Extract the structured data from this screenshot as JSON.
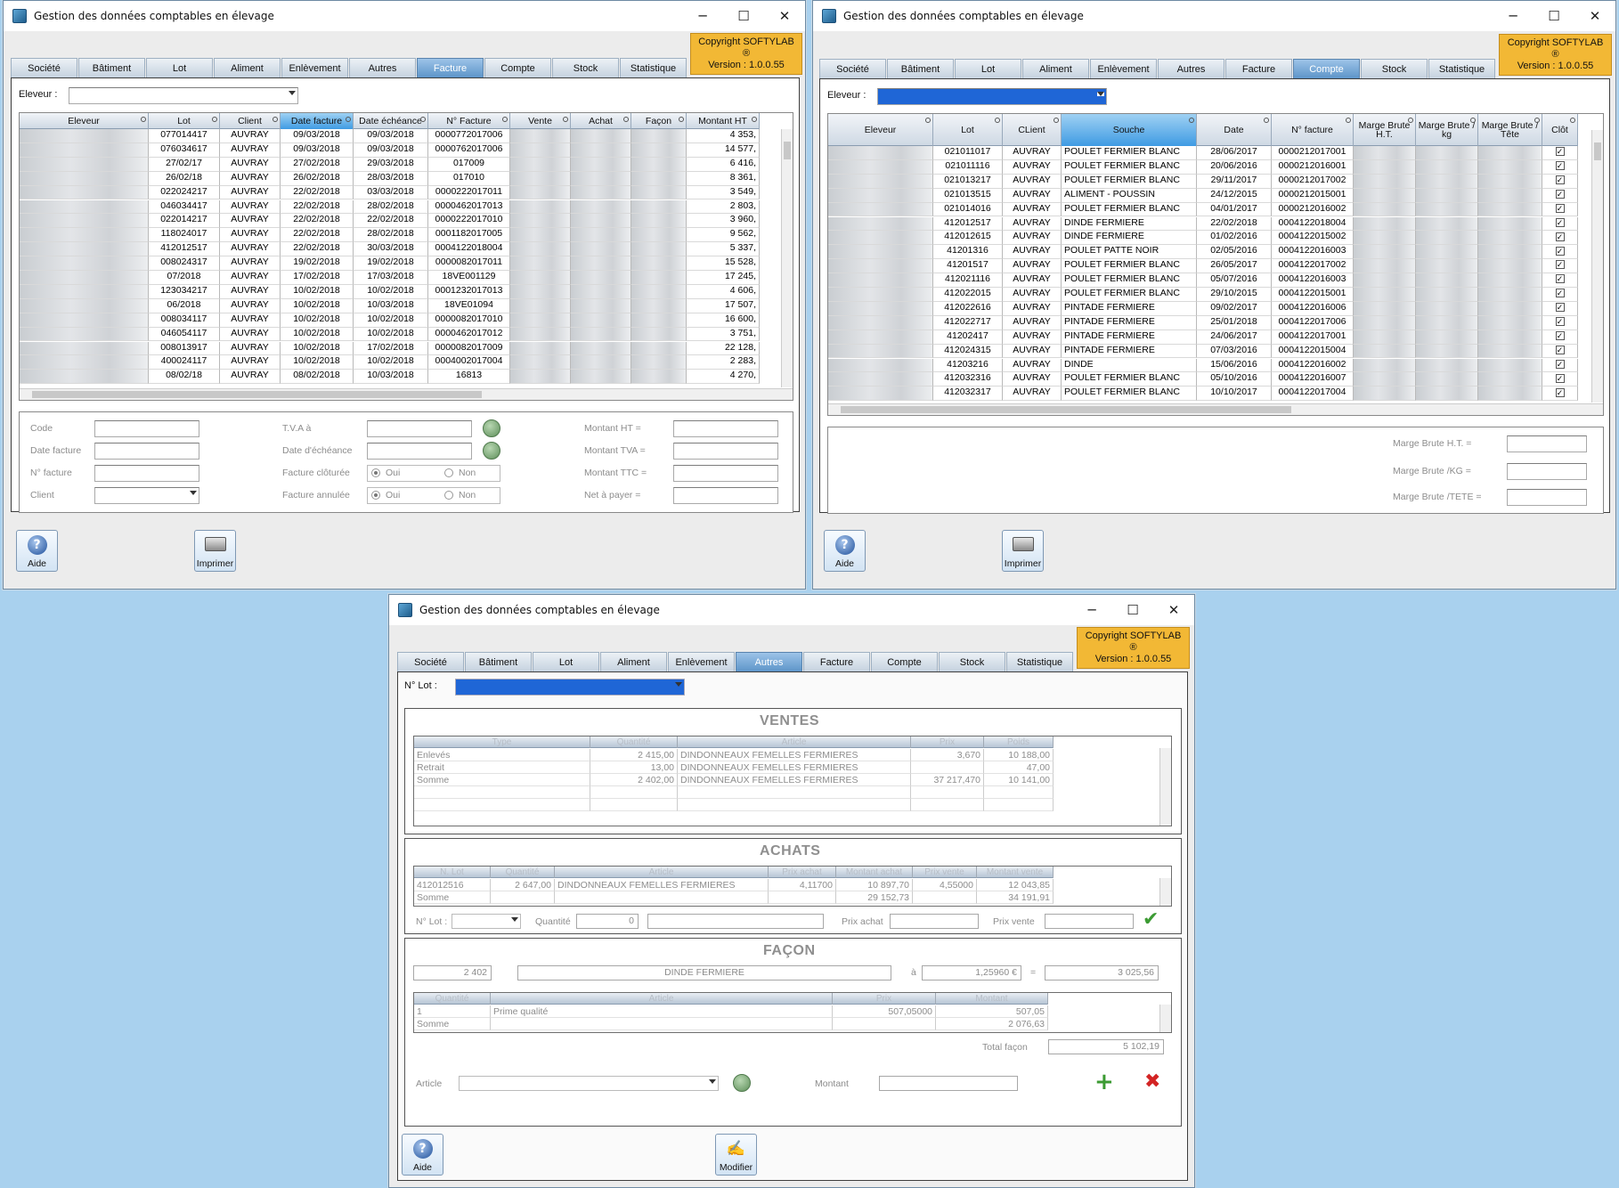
{
  "app": {
    "title": "Gestion des données comptables en élevage",
    "copyright_line1": "Copyright SOFTYLAB ®",
    "copyright_line2": "Version : 1.0.0.55",
    "win_min": "─",
    "win_max": "☐",
    "win_close": "✕"
  },
  "tabs": [
    "Société",
    "Bâtiment",
    "Lot",
    "Aliment",
    "Enlèvement",
    "Autres",
    "Facture",
    "Compte",
    "Stock",
    "Statistique"
  ],
  "w1": {
    "active_tab": "Facture",
    "eleveur_label": "Eleveur :",
    "columns": [
      "Eleveur",
      "Lot",
      "Client",
      "Date facture",
      "Date échéance",
      "N° Facture",
      "Vente",
      "Achat",
      "Façon",
      "Montant HT"
    ],
    "rows": [
      [
        "",
        "077014417",
        "AUVRAY",
        "09/03/2018",
        "09/03/2018",
        "0000772017006",
        "",
        "",
        "",
        "4 353,"
      ],
      [
        "",
        "076034617",
        "AUVRAY",
        "09/03/2018",
        "09/03/2018",
        "0000762017006",
        "",
        "",
        "",
        "14 577,"
      ],
      [
        "",
        "27/02/17",
        "AUVRAY",
        "27/02/2018",
        "29/03/2018",
        "017009",
        "",
        "",
        "",
        "6 416,"
      ],
      [
        "",
        "26/02/18",
        "AUVRAY",
        "26/02/2018",
        "28/03/2018",
        "017010",
        "",
        "",
        "",
        "8 361,"
      ],
      [
        "",
        "022024217",
        "AUVRAY",
        "22/02/2018",
        "03/03/2018",
        "0000222017011",
        "",
        "",
        "",
        "3 549,"
      ],
      [
        "",
        "046034417",
        "AUVRAY",
        "22/02/2018",
        "28/02/2018",
        "0000462017013",
        "",
        "",
        "",
        "2 803,"
      ],
      [
        "",
        "022014217",
        "AUVRAY",
        "22/02/2018",
        "22/02/2018",
        "0000222017010",
        "",
        "",
        "",
        "3 960,"
      ],
      [
        "",
        "118024017",
        "AUVRAY",
        "22/02/2018",
        "28/02/2018",
        "0001182017005",
        "",
        "",
        "",
        "9 562,"
      ],
      [
        "",
        "412012517",
        "AUVRAY",
        "22/02/2018",
        "30/03/2018",
        "0004122018004",
        "",
        "",
        "",
        "5 337,"
      ],
      [
        "",
        "008024317",
        "AUVRAY",
        "19/02/2018",
        "19/02/2018",
        "0000082017011",
        "",
        "",
        "",
        "15 528,"
      ],
      [
        "",
        "07/2018",
        "AUVRAY",
        "17/02/2018",
        "17/03/2018",
        "18VE001129",
        "",
        "",
        "",
        "17 245,"
      ],
      [
        "",
        "123034217",
        "AUVRAY",
        "10/02/2018",
        "10/02/2018",
        "0001232017013",
        "",
        "",
        "",
        "4 606,"
      ],
      [
        "",
        "06/2018",
        "AUVRAY",
        "10/02/2018",
        "10/03/2018",
        "18VE01094",
        "",
        "",
        "",
        "17 507,"
      ],
      [
        "",
        "008034117",
        "AUVRAY",
        "10/02/2018",
        "10/02/2018",
        "0000082017010",
        "",
        "",
        "",
        "16 600,"
      ],
      [
        "",
        "046054117",
        "AUVRAY",
        "10/02/2018",
        "10/02/2018",
        "0000462017012",
        "",
        "",
        "",
        "3 751,"
      ],
      [
        "",
        "008013917",
        "AUVRAY",
        "10/02/2018",
        "17/02/2018",
        "0000082017009",
        "",
        "",
        "",
        "22 128,"
      ],
      [
        "",
        "400024117",
        "AUVRAY",
        "10/02/2018",
        "10/02/2018",
        "0004002017004",
        "",
        "",
        "",
        "2 283,"
      ],
      [
        "",
        "08/02/18",
        "AUVRAY",
        "08/02/2018",
        "10/03/2018",
        "16813",
        "",
        "",
        "",
        "4 270,"
      ]
    ],
    "form": {
      "code": "Code",
      "date_facture": "Date facture",
      "n_facture": "N° facture",
      "client": "Client",
      "tva": "T.V.A à",
      "date_echeance": "Date d'échéance",
      "facture_cloturee": "Facture clôturée",
      "facture_annulee": "Facture annulée",
      "oui": "Oui",
      "non": "Non",
      "montant_ht": "Montant HT =",
      "montant_tva": "Montant TVA =",
      "montant_ttc": "Montant TTC =",
      "net_a_payer": "Net à payer ="
    },
    "btn_aide": "Aide",
    "btn_imprimer": "Imprimer"
  },
  "w2": {
    "active_tab": "Compte",
    "eleveur_label": "Eleveur :",
    "columns": [
      "Eleveur",
      "Lot",
      "CLient",
      "Souche",
      "Date",
      "N° facture",
      "Marge Brute H.T.",
      "Marge Brute / kg",
      "Marge Brute / Tête",
      "Clôt"
    ],
    "rows": [
      [
        "",
        "021011017",
        "AUVRAY",
        "POULET FERMIER BLANC",
        "28/06/2017",
        "0000212017001"
      ],
      [
        "",
        "021011116",
        "AUVRAY",
        "POULET FERMIER BLANC",
        "20/06/2016",
        "0000212016001"
      ],
      [
        "",
        "021013217",
        "AUVRAY",
        "POULET FERMIER BLANC",
        "29/11/2017",
        "0000212017002"
      ],
      [
        "",
        "021013515",
        "AUVRAY",
        "ALIMENT - POUSSIN",
        "24/12/2015",
        "0000212015001"
      ],
      [
        "",
        "021014016",
        "AUVRAY",
        "POULET FERMIER BLANC",
        "04/01/2017",
        "0000212016002"
      ],
      [
        "",
        "412012517",
        "AUVRAY",
        "DINDE FERMIERE",
        "22/02/2018",
        "0004122018004"
      ],
      [
        "",
        "412012615",
        "AUVRAY",
        "DINDE FERMIERE",
        "01/02/2016",
        "0004122015002"
      ],
      [
        "",
        "41201316",
        "AUVRAY",
        "POULET PATTE NOIR",
        "02/05/2016",
        "0004122016003"
      ],
      [
        "",
        "41201517",
        "AUVRAY",
        "POULET FERMIER BLANC",
        "26/05/2017",
        "0004122017002"
      ],
      [
        "",
        "412021116",
        "AUVRAY",
        "POULET FERMIER BLANC",
        "05/07/2016",
        "0004122016003"
      ],
      [
        "",
        "412022015",
        "AUVRAY",
        "POULET FERMIER BLANC",
        "29/10/2015",
        "0004122015001"
      ],
      [
        "",
        "412022616",
        "AUVRAY",
        "PINTADE FERMIERE",
        "09/02/2017",
        "0004122016006"
      ],
      [
        "",
        "412022717",
        "AUVRAY",
        "PINTADE FERMIERE",
        "25/01/2018",
        "0004122017006"
      ],
      [
        "",
        "41202417",
        "AUVRAY",
        "PINTADE FERMIERE",
        "24/06/2017",
        "0004122017001"
      ],
      [
        "",
        "412024315",
        "AUVRAY",
        "PINTADE FERMIERE",
        "07/03/2016",
        "0004122015004"
      ],
      [
        "",
        "41203216",
        "AUVRAY",
        "DINDE",
        "15/06/2016",
        "0004122016002"
      ],
      [
        "",
        "412032316",
        "AUVRAY",
        "POULET FERMIER BLANC",
        "05/10/2016",
        "0004122016007"
      ],
      [
        "",
        "412032317",
        "AUVRAY",
        "POULET FERMIER BLANC",
        "10/10/2017",
        "0004122017004"
      ]
    ],
    "check": "✓",
    "form": {
      "marge_ht": "Marge Brute H.T. =",
      "marge_kg": "Marge Brute /KG =",
      "marge_tete": "Marge Brute /TETE ="
    },
    "btn_aide": "Aide",
    "btn_imprimer": "Imprimer"
  },
  "w3": {
    "active_tab": "Autres",
    "nlot_label": "N° Lot :",
    "ventes": {
      "title": "VENTES",
      "columns": [
        "Type",
        "Quantité",
        "Article",
        "Prix",
        "Poids"
      ],
      "rows": [
        [
          "Enlevés",
          "2 415,00",
          "DINDONNEAUX FEMELLES FERMIERES",
          "3,670",
          "10 188,00"
        ],
        [
          "Retrait",
          "13,00",
          "DINDONNEAUX FEMELLES FERMIERES",
          "",
          "47,00"
        ],
        [
          "Somme",
          "2 402,00",
          "DINDONNEAUX FEMELLES FERMIERES",
          "37 217,470",
          "10 141,00"
        ]
      ]
    },
    "achats": {
      "title": "ACHATS",
      "columns": [
        "N. Lot",
        "Quantité",
        "Article",
        "Prix achat",
        "Montant achat",
        "Prix vente",
        "Montant vente"
      ],
      "rows": [
        [
          "412012516",
          "2 647,00",
          "DINDONNEAUX FEMELLES FERMIERES",
          "4,11700",
          "10 897,70",
          "4,55000",
          "12 043,85"
        ]
      ],
      "sum_label": "Somme",
      "sum_achat": "29 152,73",
      "sum_vente": "34 191,91",
      "nlot": "N° Lot :",
      "quantite": "Quantité",
      "quantite_val": "0",
      "prix_achat": "Prix achat",
      "prix_vente": "Prix vente"
    },
    "facon": {
      "title": "FAÇON",
      "qty": "2 402",
      "article": "DINDE FERMIERE",
      "a": "à",
      "prix": "1,25960 €",
      "eq": "=",
      "total": "3 025,56",
      "columns": [
        "Quantité",
        "Article",
        "Prix",
        "Montant"
      ],
      "rows": [
        [
          "1",
          "Prime qualité",
          "507,05000",
          "507,05"
        ]
      ],
      "sum_label": "Somme",
      "sum": "2 076,63",
      "total_facon_label": "Total façon",
      "total_facon": "5 102,19",
      "article_label": "Article",
      "montant_label": "Montant"
    },
    "btn_aide": "Aide",
    "btn_modifier": "Modifier"
  }
}
